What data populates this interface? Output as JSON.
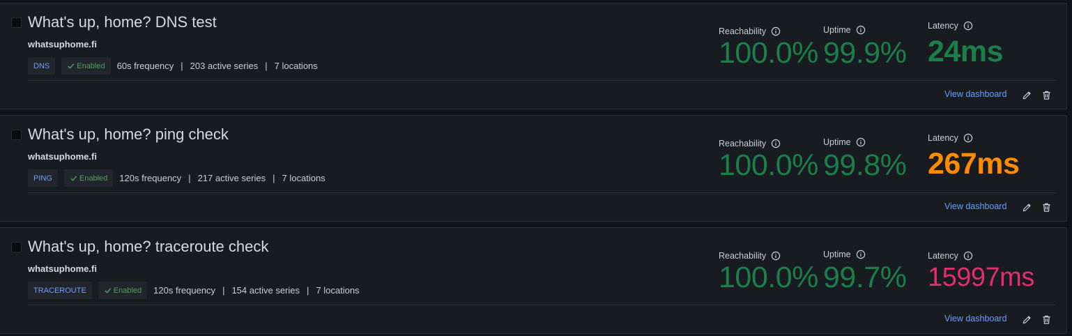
{
  "checks": [
    {
      "title": "What's up, home? DNS test",
      "target": "whatsuphome.fi",
      "type": "DNS",
      "status": "Enabled",
      "frequency": "60s frequency",
      "series": "203 active series",
      "locations": "7 locations",
      "reachability_label": "Reachability",
      "reachability": "100.0%",
      "uptime_label": "Uptime",
      "uptime": "99.9%",
      "latency_label": "Latency",
      "latency": "24ms",
      "latency_color": "#1a7f4b",
      "view_label": "View dashboard"
    },
    {
      "title": "What's up, home? ping check",
      "target": "whatsuphome.fi",
      "type": "PING",
      "status": "Enabled",
      "frequency": "120s frequency",
      "series": "217 active series",
      "locations": "7 locations",
      "reachability_label": "Reachability",
      "reachability": "100.0%",
      "uptime_label": "Uptime",
      "uptime": "99.8%",
      "latency_label": "Latency",
      "latency": "267ms",
      "latency_color": "#ff8c00",
      "view_label": "View dashboard"
    },
    {
      "title": "What's up, home? traceroute check",
      "target": "whatsuphome.fi",
      "type": "TRACEROUTE",
      "status": "Enabled",
      "frequency": "120s frequency",
      "series": "154 active series",
      "locations": "7 locations",
      "reachability_label": "Reachability",
      "reachability": "100.0%",
      "uptime_label": "Uptime",
      "uptime": "99.7%",
      "latency_label": "Latency",
      "latency": "15997ms",
      "latency_color": "#e02f6b",
      "view_label": "View dashboard"
    }
  ],
  "icons": {
    "info": "info-circle-icon",
    "check": "check-icon",
    "edit": "pencil-icon",
    "delete": "trash-icon"
  },
  "colors": {
    "metric_green": "#1a7f4b",
    "link_blue": "#6e9fff",
    "enabled_green": "#46a661"
  }
}
